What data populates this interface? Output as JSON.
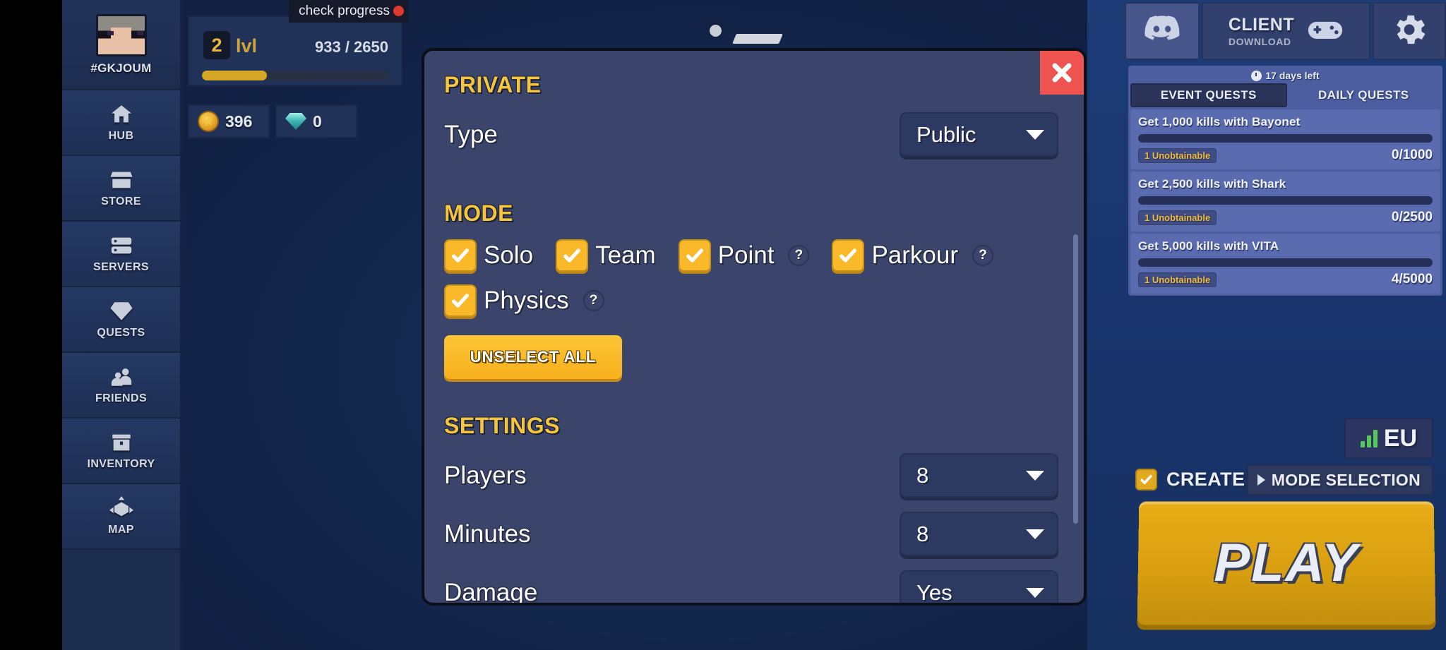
{
  "profile": {
    "name": "#GKJOUM",
    "level": "2",
    "level_suffix": "lvl",
    "xp": "933 / 2650",
    "xp_percent": 35,
    "check_progress": "check progress"
  },
  "currencies": [
    {
      "icon": "coin-icon",
      "value": "396"
    },
    {
      "icon": "gem-icon",
      "value": "0"
    }
  ],
  "sidebar": {
    "items": [
      {
        "label": "HUB",
        "icon": "home-icon"
      },
      {
        "label": "STORE",
        "icon": "store-icon"
      },
      {
        "label": "SERVERS",
        "icon": "server-icon"
      },
      {
        "label": "QUESTS",
        "icon": "diamond-icon"
      },
      {
        "label": "FRIENDS",
        "icon": "people-icon"
      },
      {
        "label": "INVENTORY",
        "icon": "chest-icon"
      },
      {
        "label": "MAP",
        "icon": "cube-icon"
      }
    ]
  },
  "modal": {
    "close_icon": "close-icon",
    "private": {
      "title": "PRIVATE",
      "type_label": "Type",
      "type_value": "Public"
    },
    "mode": {
      "title": "MODE",
      "options": [
        {
          "label": "Solo",
          "checked": true,
          "help": false
        },
        {
          "label": "Team",
          "checked": true,
          "help": false
        },
        {
          "label": "Point",
          "checked": true,
          "help": true
        },
        {
          "label": "Parkour",
          "checked": true,
          "help": true
        },
        {
          "label": "Physics",
          "checked": true,
          "help": true
        }
      ],
      "help_glyph": "?",
      "unselect_all": "UNSELECT ALL"
    },
    "settings": {
      "title": "SETTINGS",
      "rows": [
        {
          "label": "Players",
          "value": "8"
        },
        {
          "label": "Minutes",
          "value": "8"
        },
        {
          "label": "Damage",
          "value": "Yes"
        }
      ]
    }
  },
  "right": {
    "discord_icon": "discord-icon",
    "client": {
      "title": "CLIENT",
      "subtitle": "DOWNLOAD",
      "icon": "gamepad-icon"
    },
    "gear_icon": "gear-icon",
    "quests": {
      "days_left": "17 days left",
      "clock_icon": "clock-icon",
      "tabs": [
        {
          "label": "EVENT QUESTS",
          "active": true
        },
        {
          "label": "DAILY QUESTS",
          "active": false
        }
      ],
      "items": [
        {
          "title": "Get 1,000 kills with Bayonet",
          "badge": "1 Unobtainable",
          "count": "0/1000",
          "progress": 0
        },
        {
          "title": "Get 2,500 kills with Shark",
          "badge": "1 Unobtainable",
          "count": "0/2500",
          "progress": 0
        },
        {
          "title": "Get 5,000 kills with VITA",
          "badge": "1 Unobtainable",
          "count": "4/5000",
          "progress": 0
        }
      ]
    },
    "region": {
      "label": "EU",
      "icon": "signal-bars-icon"
    },
    "create": {
      "label": "CREATE",
      "checked": true
    },
    "mode_selection": {
      "label": "MODE SELECTION",
      "icon": "triangle-right-icon"
    },
    "play": "PLAY"
  },
  "colors": {
    "accent_yellow": "#f6c53f",
    "play_gold": "#d99f10",
    "close_red": "#ef5350",
    "panel_blue": "#3b456b",
    "sidebar_blue": "#1d2d50",
    "quest_blue": "#5a6bb0",
    "signal_green": "#57c95a"
  }
}
